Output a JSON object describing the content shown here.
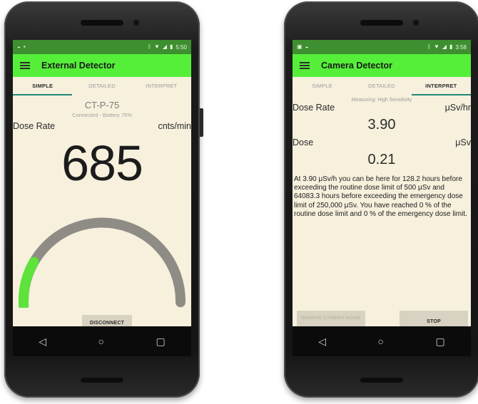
{
  "left_phone": {
    "status": {
      "left_icons": [
        "◒",
        "▪"
      ],
      "time": "5:50"
    },
    "app_title": "External Detector",
    "tabs": [
      "SIMPLE",
      "DETAILED",
      "INTERPRET"
    ],
    "active_tab": 0,
    "device_name": "CT-P-75",
    "connection": "Connected - Battery 75%",
    "dose_rate_label": "Dose Rate",
    "dose_rate_unit": "cnts/min",
    "dose_rate_value": "685",
    "gauge_level": 0.18,
    "disconnect_label": "DISCONNECT"
  },
  "right_phone": {
    "status": {
      "left_icons": [
        "▣",
        "◒"
      ],
      "time": "3:58"
    },
    "app_title": "Camera Detector",
    "tabs": [
      "SIMPLE",
      "DETAILED",
      "INTERPRET"
    ],
    "active_tab": 2,
    "measuring": "Measuring: High Sensitivity",
    "dose_rate_label": "Dose Rate",
    "dose_rate_unit": "μSv/hr",
    "dose_rate_value": "3.90",
    "dose_label": "Dose",
    "dose_unit": "μSv",
    "dose_value": "0.21",
    "interpretation": "At 3.90 μSv/h you can be here for 128.2 hours before exceeding the routine dose limit of 500 μSv and 64083.3 hours before exceeding the emergency dose limit of 250,000 μSv. You have reached 0 % of the routine dose limit and 0 % of the emergency dose limit.",
    "remove_noise_label": "REMOVE CAMERA NOISE",
    "stop_label": "STOP"
  },
  "nav": {
    "back": "◁",
    "home": "○",
    "recents": "▢"
  },
  "colors": {
    "appbar": "#55ef3a",
    "statusbar": "#3e8f2f",
    "gauge_fill": "#5ee23c",
    "gauge_track": "#8f8c86",
    "screen_bg": "#f6f0dd"
  }
}
